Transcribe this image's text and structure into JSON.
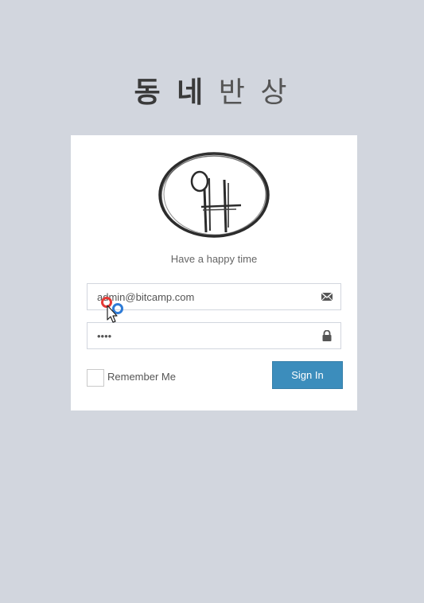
{
  "header": {
    "title_bold": "동 네",
    "title_light": "반 상"
  },
  "card": {
    "logo_icon": "circle-hand-drawn-logo",
    "tagline": "Have a happy time",
    "email": {
      "value": "admin@bitcamp.com",
      "icon": "envelope-icon"
    },
    "password": {
      "value": "••••",
      "icon": "lock-icon"
    },
    "remember_label": "Remember Me",
    "signin_label": "Sign In"
  },
  "colors": {
    "background": "#d2d6de",
    "card": "#ffffff",
    "primary": "#3c8dbc",
    "cursor_red": "#e53935",
    "cursor_blue": "#2e7bd6"
  }
}
